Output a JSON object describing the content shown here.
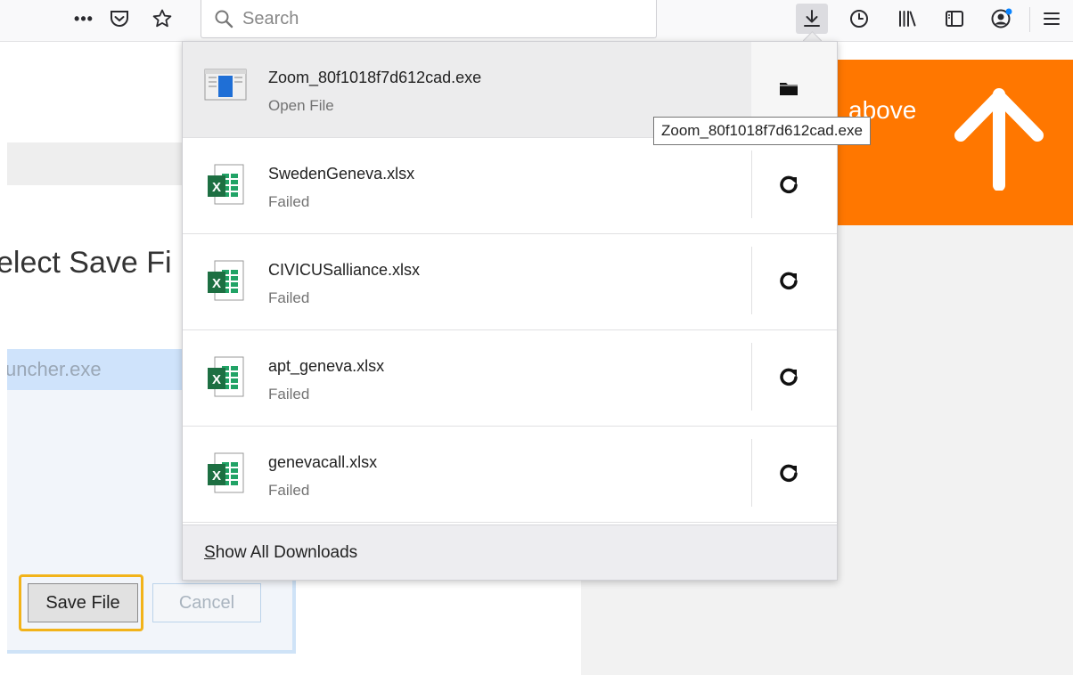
{
  "toolbar": {
    "overflow_label": "•••",
    "search_placeholder": "Search",
    "icons": [
      "overflow-icon",
      "pocket-icon",
      "star-icon",
      "search-icon",
      "download-icon",
      "history-icon",
      "library-icon",
      "sidebar-icon",
      "account-icon",
      "menu-icon"
    ]
  },
  "background_page": {
    "heading": "elect Save Fi",
    "filename_value": "uncher.exe",
    "save_button": "Save File",
    "cancel_button": "Cancel",
    "orange_card_text": "above",
    "orange_color": "#ff7700",
    "highlight_color": "#f2b31a"
  },
  "downloads": {
    "items": [
      {
        "name": "Zoom_80f1018f7d612cad.exe",
        "status": "Open File",
        "type": "exe",
        "action": "folder-icon"
      },
      {
        "name": "SwedenGeneva.xlsx",
        "status": "Failed",
        "type": "xlsx",
        "action": "retry-icon"
      },
      {
        "name": "CIVICUSalliance.xlsx",
        "status": "Failed",
        "type": "xlsx",
        "action": "retry-icon"
      },
      {
        "name": "apt_geneva.xlsx",
        "status": "Failed",
        "type": "xlsx",
        "action": "retry-icon"
      },
      {
        "name": "genevacall.xlsx",
        "status": "Failed",
        "type": "xlsx",
        "action": "retry-icon"
      }
    ],
    "footer_access_key": "S",
    "footer_rest": "how All Downloads"
  },
  "tooltip": {
    "text": "Zoom_80f1018f7d612cad.exe"
  }
}
